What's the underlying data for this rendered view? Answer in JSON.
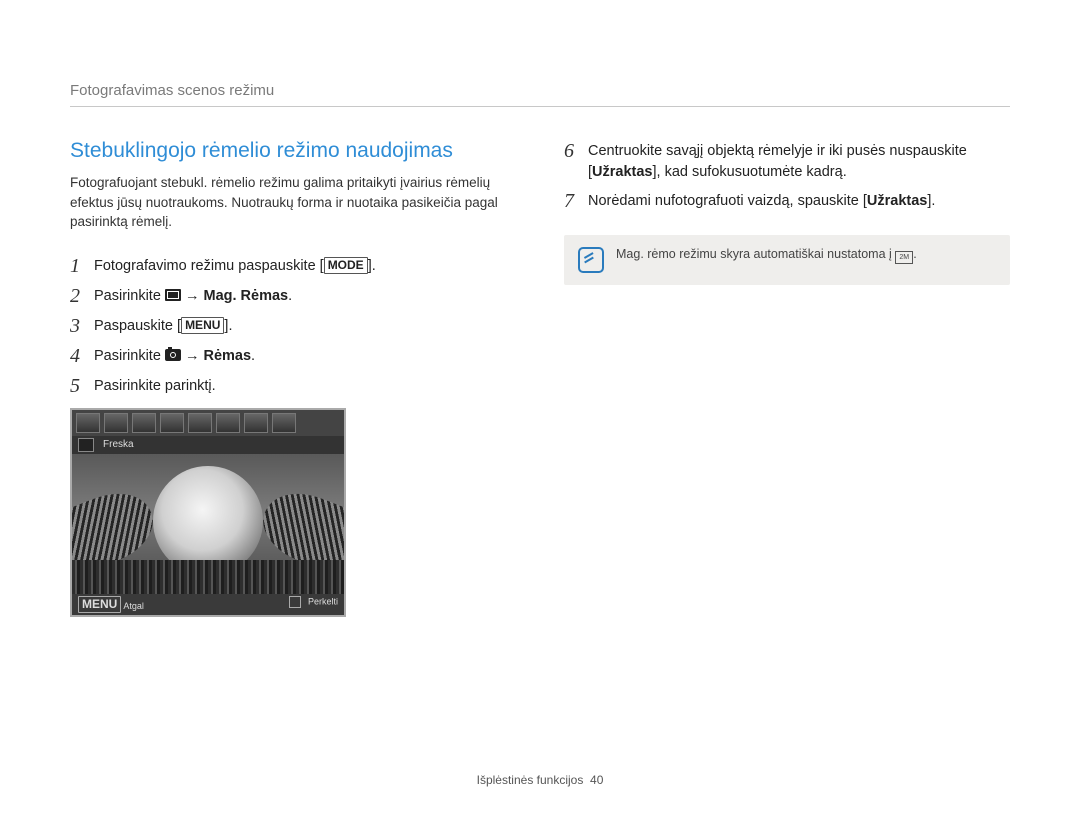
{
  "header": "Fotografavimas scenos režimu",
  "section_title": "Stebuklingojo rėmelio režimo naudojimas",
  "intro": "Fotografuojant stebukl. rėmelio režimu galima pritaikyti įvairius rėmelių efektus jūsų nuotraukoms. Nuotraukų forma ir nuotaika pasikeičia pagal pasirinktą rėmelį.",
  "steps_left": {
    "1": {
      "text": "Fotografavimo režimu paspauskite ",
      "button": "MODE",
      "tail": "."
    },
    "2": {
      "text": "Pasirinkite ",
      "icon": "scn-icon",
      "arrow": " → ",
      "bold": "Mag. Rėmas",
      "tail": "."
    },
    "3": {
      "text": "Paspauskite ",
      "button": "MENU",
      "tail": "."
    },
    "4": {
      "text": "Pasirinkite ",
      "icon": "camera-icon",
      "arrow": " → ",
      "bold": "Rėmas",
      "tail": "."
    },
    "5": {
      "text": "Pasirinkite parinktį."
    }
  },
  "preview": {
    "label": "Freska",
    "footer_left_btn": "MENU",
    "footer_left": "Atgal",
    "footer_right": "Perkelti"
  },
  "steps_right": {
    "6": {
      "pre": "Centruokite savąjį objektą rėmelyje ir iki pusės nuspauskite [",
      "bold": "Užraktas",
      "post": "], kad sufokusuotumėte kadrą."
    },
    "7": {
      "pre": "Norėdami nufotografuoti vaizdą, spauskite [",
      "bold": "Užraktas",
      "post": "]."
    }
  },
  "note": {
    "text_pre": "Mag. rėmo režimu skyra automatiškai nustatoma į ",
    "res": "2M",
    "text_post": "."
  },
  "footer": {
    "section": "Išplėstinės funkcijos",
    "page": "40"
  }
}
